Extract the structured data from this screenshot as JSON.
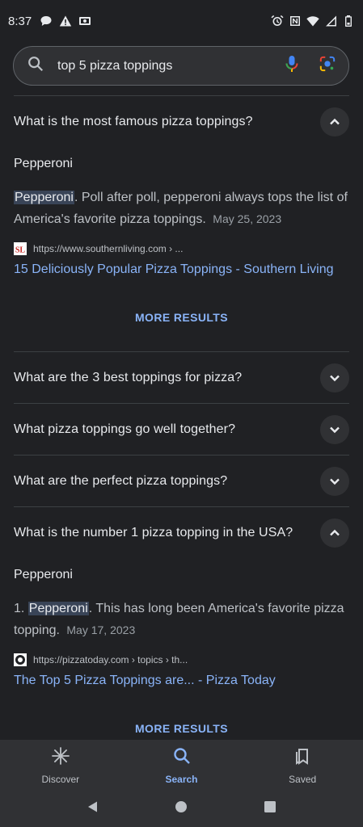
{
  "status_bar": {
    "time": "8:37"
  },
  "search": {
    "query": "top 5 pizza toppings"
  },
  "faqs": [
    {
      "question": "What is the most famous pizza toppings?",
      "expanded": true,
      "answer_title": "Pepperoni",
      "answer_highlight": "Pepperoni",
      "answer_prefix": "",
      "answer_rest": ". Poll after poll, pepperoni always tops the list of America's favorite pizza toppings.",
      "date": "May 25, 2023",
      "source_url": "https://www.southernliving.com › ...",
      "source_title": "15 Deliciously Popular Pizza Toppings - Southern Living",
      "favicon": "southern-living-icon",
      "more_label": "MORE RESULTS"
    },
    {
      "question": "What are the 3 best toppings for pizza?",
      "expanded": false
    },
    {
      "question": "What pizza toppings go well together?",
      "expanded": false
    },
    {
      "question": "What are the perfect pizza toppings?",
      "expanded": false
    },
    {
      "question": "What is the number 1 pizza topping in the USA?",
      "expanded": true,
      "answer_title": "Pepperoni",
      "answer_prefix": "1. ",
      "answer_highlight": "Pepperoni",
      "answer_rest": ". This has long been America's favorite pizza topping.",
      "date": "May 17, 2023",
      "source_url": "https://pizzatoday.com › topics › th...",
      "source_title": "The Top 5 Pizza Toppings are... - Pizza Today",
      "favicon": "pizza-today-icon",
      "more_label": "MORE RESULTS"
    }
  ],
  "bottom_nav": {
    "items": [
      {
        "label": "Discover",
        "icon": "asterisk-icon"
      },
      {
        "label": "Search",
        "icon": "search-icon",
        "active": true
      },
      {
        "label": "Saved",
        "icon": "bookmark-icon"
      }
    ]
  },
  "colors": {
    "background": "#202124",
    "accent": "#8ab4f8",
    "surface": "#303134"
  }
}
